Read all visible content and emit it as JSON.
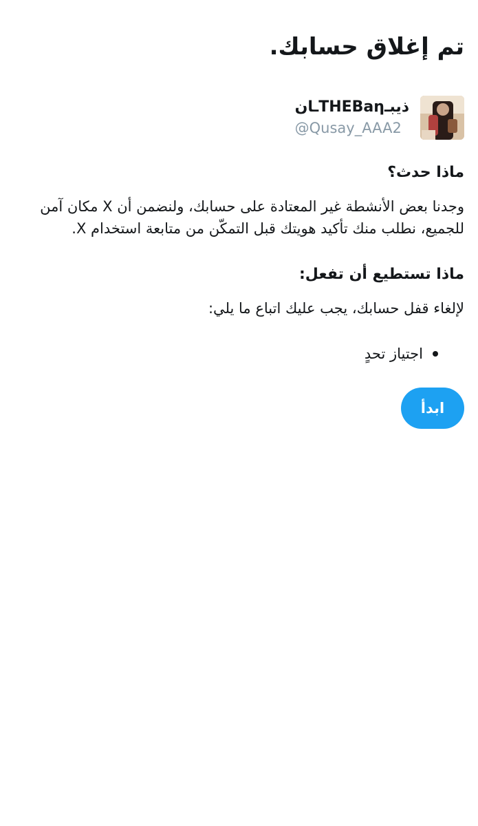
{
  "page": {
    "title": "تم إغلاق حسابك."
  },
  "account": {
    "display_name": "ذيبـTHEBaηـان",
    "handle": "@Qusay_AAA2"
  },
  "what_happened": {
    "heading": "ماذا حدث؟",
    "body": "وجدنا بعض الأنشطة غير المعتادة على حسابك، ولنضمن أن X مكان آمن للجميع، نطلب منك تأكيد هويتك قبل التمكّن من متابعة استخدام X."
  },
  "what_you_can_do": {
    "heading": "ماذا تستطيع أن تفعل:",
    "body": "لإلغاء قفل حسابك، يجب عليك اتباع ما يلي:",
    "steps": [
      "اجتياز تحدٍ"
    ]
  },
  "actions": {
    "start_label": "ابدأ"
  },
  "colors": {
    "accent": "#1da1f2",
    "text_primary": "#14171a",
    "text_secondary": "#8899a6",
    "background": "#ffffff"
  }
}
